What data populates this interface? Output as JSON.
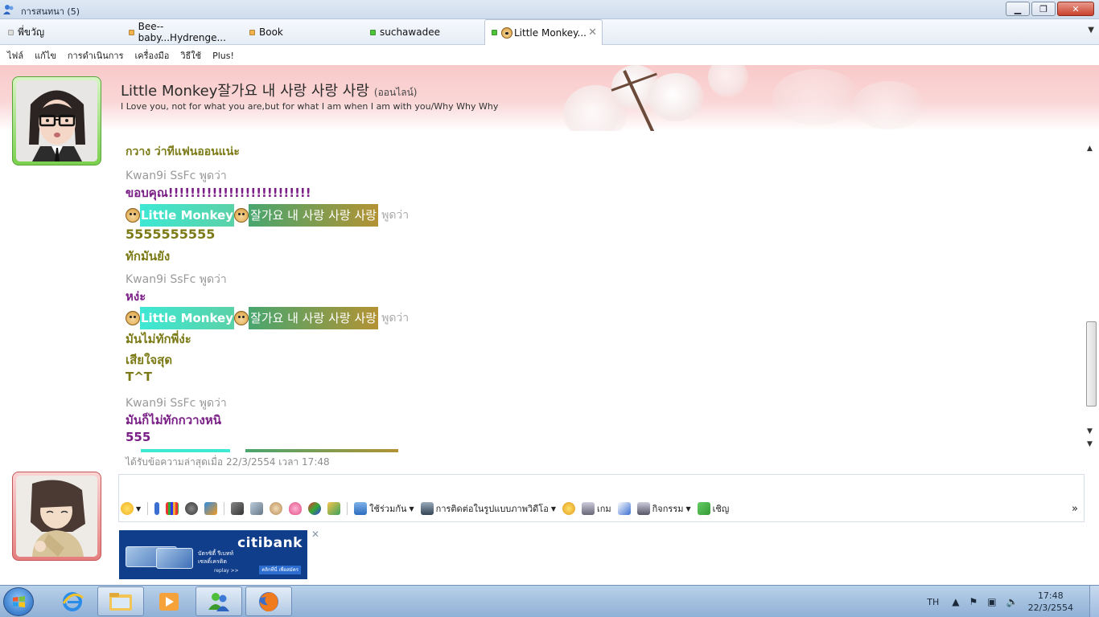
{
  "window": {
    "title": "การสนทนา (5)",
    "minimize": "▁",
    "maximize": "❐",
    "close": "✕"
  },
  "tabs": [
    {
      "label": "พี่ขวัญ",
      "color": "#dddddd"
    },
    {
      "label": "Bee--baby...Hydrenge...",
      "color": "#f2b24e"
    },
    {
      "label": "Book",
      "color": "#f2b24e"
    },
    {
      "label": "suchawadee",
      "color": "#4fc43a"
    },
    {
      "label": "Little Monkey...",
      "color": "#4fc43a"
    }
  ],
  "tab_close": "✕",
  "tab_menu": "▼",
  "menu": [
    "ไฟล์",
    "แก้ไข",
    "การดำเนินการ",
    "เครื่องมือ",
    "วิธีใช้",
    "Plus!"
  ],
  "contact": {
    "name": "Little Monkey잘가요 내 사랑 사랑 사랑",
    "status": "(ออนไลน์)",
    "personal_message": "I Love you, not for what you are,but for what I am when I am with you/Why Why Why"
  },
  "chat": {
    "system_line": "กวาง ว่าทีแฟนออนแน่ะ",
    "nick_a": "Little Monkey",
    "nick_b": "잘가요 내 사랑 사랑 사랑",
    "says": "พูดว่า",
    "messages": [
      {
        "sender": "Kwan9i SsFc พูดว่า",
        "text": "ขอบคุณ!!!!!!!!!!!!!!!!!!!!!!!!!!"
      },
      {
        "text1": "5555555555",
        "text2": "ทักมันยัง"
      },
      {
        "sender": "Kwan9i SsFc พูดว่า",
        "text": "หง่ะ"
      },
      {
        "text1": "มันไม่ทักพี่ง่ะ",
        "text2": "เสียใจสุด",
        "text3": "T^T"
      },
      {
        "sender": "Kwan9i SsFc พูดว่า",
        "text": "มันก็ไม่ทักกวางหนิ",
        "text2": "555"
      }
    ],
    "last_received": "ได้รับข้อความล่าสุดเมื่อ 22/3/2554 เวลา 17:48"
  },
  "toolbar": {
    "share": "ใช้ร่วมกัน",
    "video": "การติดต่อในรูปแบบภาพวิดีโอ",
    "games": "เกม",
    "activities": "กิจกรรม",
    "invite": "เชิญ",
    "more": "»"
  },
  "ad": {
    "brand": "citibank",
    "line1": "บัตรซิตี้ รีเบทท์",
    "line2": "เซลดิ์เครดิต",
    "line3": "replay >>",
    "button": "คลิกที่นี่ เพื่อสมัคร",
    "close": "✕"
  },
  "taskbar": {
    "language": "TH",
    "time": "17:48",
    "date": "22/3/2554"
  }
}
